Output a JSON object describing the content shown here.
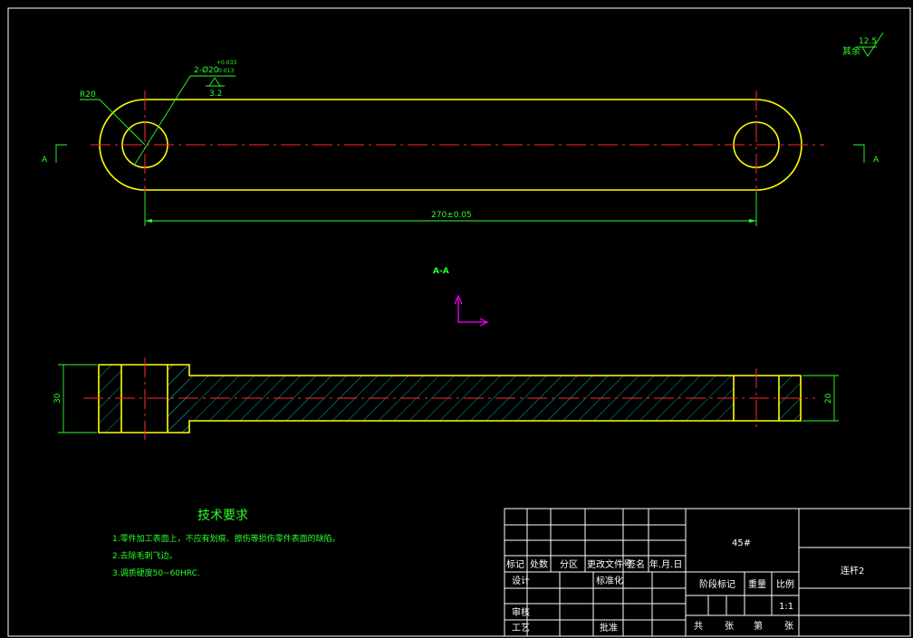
{
  "drawing": {
    "surface_note": {
      "prefix": "其余",
      "value": "12.5"
    },
    "top_view": {
      "radius_label": "R20",
      "hole_callout": "2-Ø20",
      "hole_tol_upper": "+0.033",
      "hole_tol_lower": "-0.013",
      "hole_roughness": "3.2",
      "length_dim": "270±0.05",
      "section_mark": "A"
    },
    "section_view": {
      "title": "A-A",
      "left_height": "30",
      "right_height": "20"
    },
    "tech_requirements": {
      "title": "技术要求",
      "items": [
        "1.零件加工表面上，不应有划痕、擦伤等损伤零件表面的缺陷。",
        "2.去除毛刺飞边。",
        "3.调质硬度50~60HRC."
      ]
    },
    "title_block": {
      "material": "45#",
      "part_name": "连杆2",
      "ratio": "1:1",
      "header_labels": [
        "标记",
        "处数",
        "分区",
        "更改文件号",
        "签名",
        "年.月.日"
      ],
      "row_design": "设计",
      "row_standard": "标准化",
      "row_check": "审核",
      "row_process": "工艺",
      "row_approve": "批准",
      "stage_mark": "阶段标记",
      "weight": "重量",
      "scale": "比例",
      "total_sheets": "共",
      "sheet_unit_1": "张",
      "sheet_no": "第",
      "sheet_unit_2": "张"
    }
  },
  "colors": {
    "outline": "#ffff00",
    "dimension": "#2bff2b",
    "centerline": "#ff2a2a",
    "hatch": "#00d0d0",
    "ucs": "#ff00ff",
    "frame": "#ffffff"
  }
}
